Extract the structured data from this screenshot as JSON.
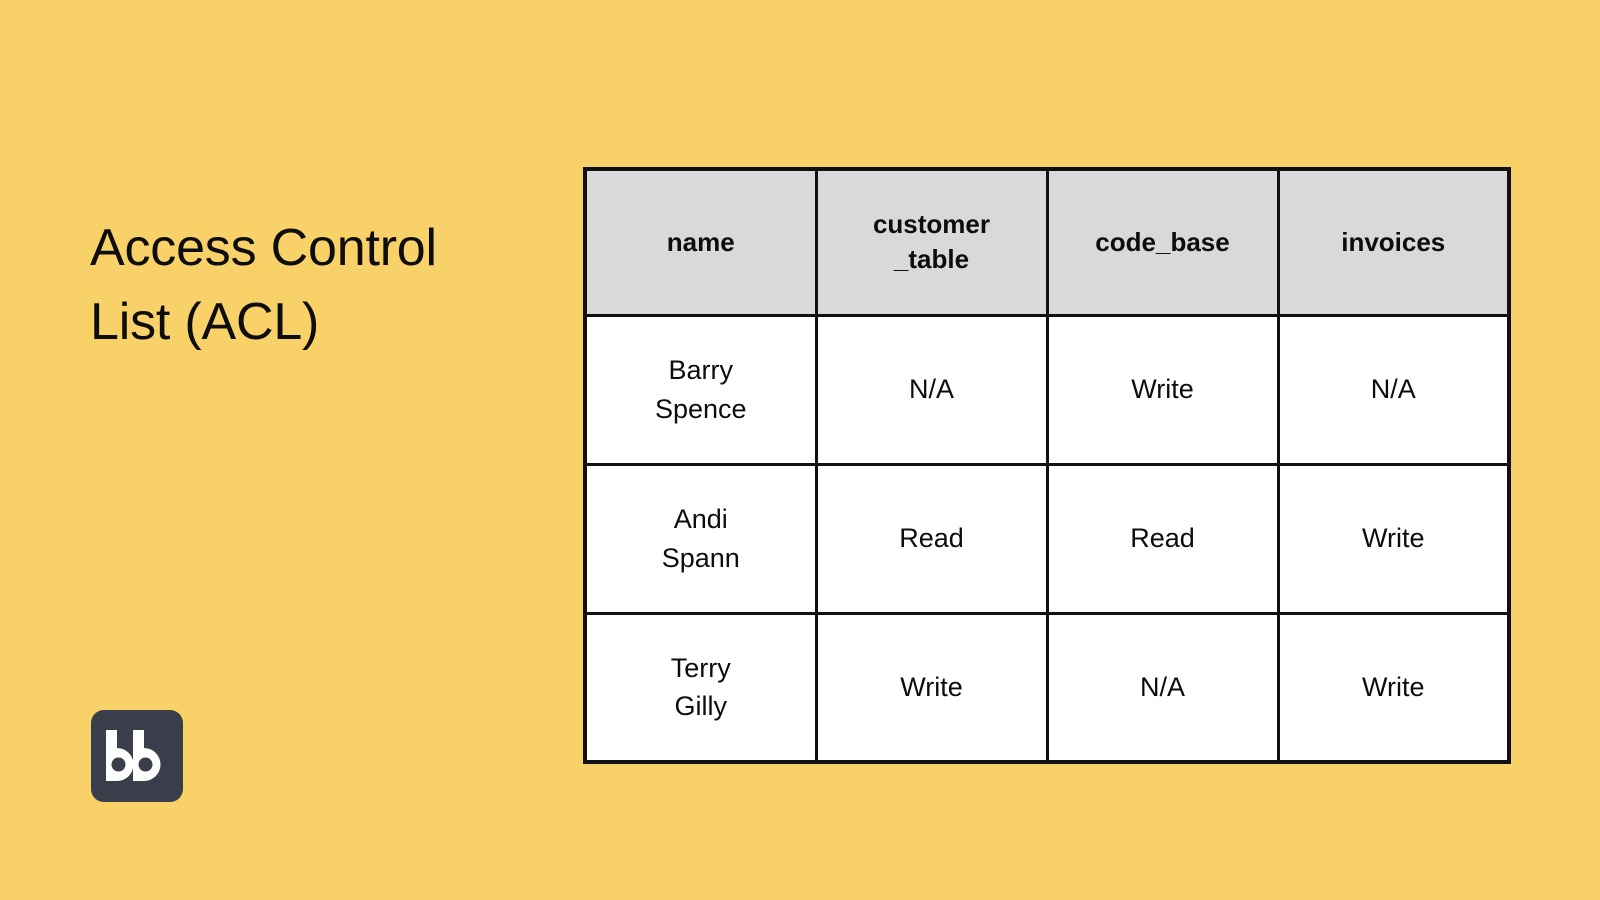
{
  "slide": {
    "title": "Access Control\nList (ACL)",
    "background_color": "#F9D169",
    "text_color": "#0D0D0D"
  },
  "logo": {
    "name": "bb-logo",
    "wordmark": "bb",
    "background_color": "#3A3E4A",
    "mark_color": "#FFFFFF"
  },
  "table": {
    "header_background": "#D9D9D9",
    "body_background": "#FFFFFF",
    "border_color": "#111111",
    "columns": [
      {
        "key": "name",
        "label": "name"
      },
      {
        "key": "customer_table",
        "label": "customer\n_table"
      },
      {
        "key": "code_base",
        "label": "code_base"
      },
      {
        "key": "invoices",
        "label": "invoices"
      }
    ],
    "rows": [
      {
        "name": "Barry\nSpence",
        "customer_table": "N/A",
        "code_base": "Write",
        "invoices": "N/A"
      },
      {
        "name": "Andi\nSpann",
        "customer_table": "Read",
        "code_base": "Read",
        "invoices": "Write"
      },
      {
        "name": "Terry\nGilly",
        "customer_table": "Write",
        "code_base": "N/A",
        "invoices": "Write"
      }
    ]
  }
}
